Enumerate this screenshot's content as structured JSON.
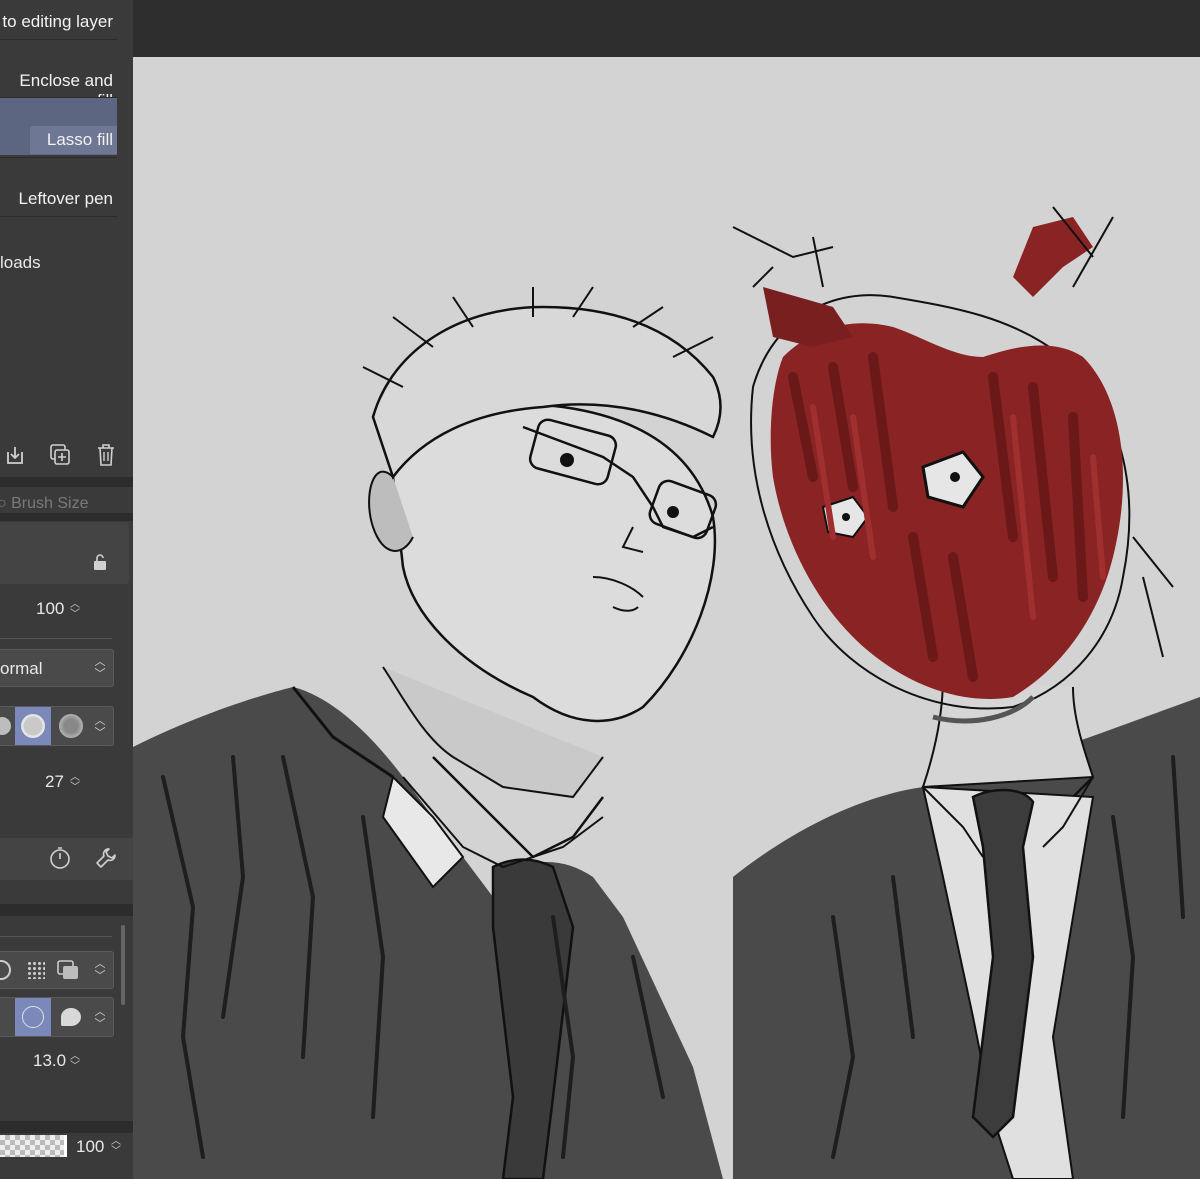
{
  "subtools": {
    "refer_editing": "to editing layer",
    "enclose_fill": "Enclose and fill",
    "lasso_fill": "Lasso fill",
    "leftover_pen": "Leftover pen",
    "downloads": "loads"
  },
  "tool_property": {
    "brush_size_tab": "Brush Size",
    "opacity_value": "100",
    "blend_mode": "ormal",
    "brush_size_value": "27",
    "thickness_value": "13.0",
    "density_value": "100"
  },
  "colors": {
    "accent_selected": "#5d6680",
    "panel_bg": "#3a3a3a",
    "canvas_bg": "#d3d3d3",
    "ink_suit": "#4a4a4a",
    "ink_red": "#8a2323"
  },
  "icons": [
    "import-icon",
    "duplicate-icon",
    "trash-icon",
    "lock-icon",
    "timer-icon",
    "wrench-icon"
  ]
}
